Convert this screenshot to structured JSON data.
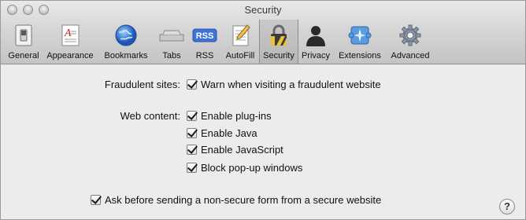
{
  "window": {
    "title": "Security"
  },
  "toolbar": {
    "items": [
      {
        "label": "General"
      },
      {
        "label": "Appearance"
      },
      {
        "label": "Bookmarks"
      },
      {
        "label": "Tabs"
      },
      {
        "label": "RSS",
        "badge": "RSS"
      },
      {
        "label": "AutoFill"
      },
      {
        "label": "Security",
        "selected": true
      },
      {
        "label": "Privacy"
      },
      {
        "label": "Extensions"
      },
      {
        "label": "Advanced"
      }
    ]
  },
  "fraudulent": {
    "label": "Fraudulent sites:",
    "option": {
      "label": "Warn when visiting a fraudulent website",
      "checked": true
    }
  },
  "web_content": {
    "label": "Web content:",
    "options": [
      {
        "label": "Enable plug-ins",
        "checked": true
      },
      {
        "label": "Enable Java",
        "checked": true
      },
      {
        "label": "Enable JavaScript",
        "checked": true
      },
      {
        "label": "Block pop-up windows",
        "checked": true
      }
    ]
  },
  "nonsecure": {
    "label": "Ask before sending a non-secure form from a secure website",
    "checked": true
  },
  "help": {
    "label": "?"
  },
  "colors": {
    "selected_tab": "#bcbcbc",
    "window_bg": "#ececec"
  }
}
